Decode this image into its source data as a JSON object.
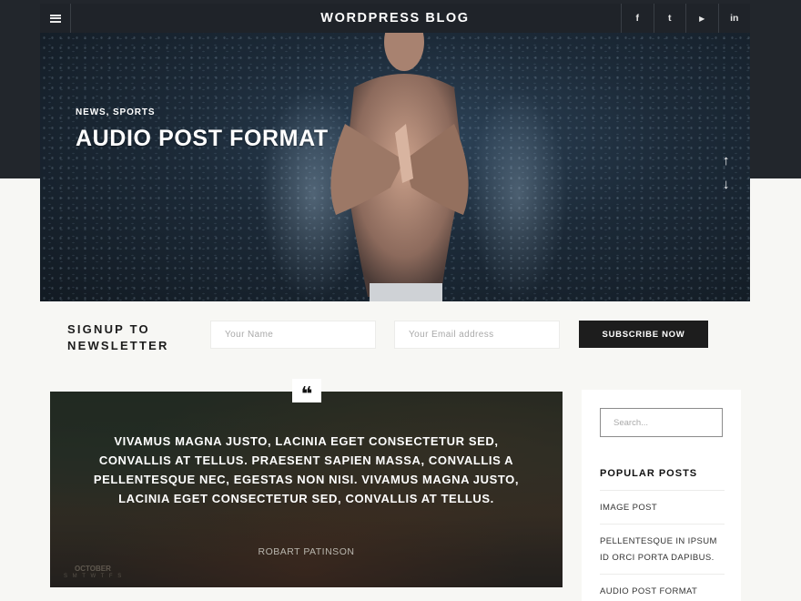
{
  "header": {
    "site_title": "WORDPRESS BLOG",
    "menu_icon": "hamburger-icon",
    "socials": [
      {
        "name": "facebook-icon",
        "glyph": "f"
      },
      {
        "name": "twitter-icon",
        "glyph": "t"
      },
      {
        "name": "youtube-icon",
        "glyph": "▶"
      },
      {
        "name": "linkedin-icon",
        "glyph": "in"
      }
    ]
  },
  "hero": {
    "categories": "NEWS, SPORTS",
    "title": "AUDIO POST FORMAT",
    "arrow_up": "↑",
    "arrow_down": "↓"
  },
  "newsletter": {
    "title_line1": "SIGNUP TO",
    "title_line2": "NEWSLETTER",
    "name_placeholder": "Your Name",
    "email_placeholder": "Your Email address",
    "button_label": "SUBSCRIBE NOW"
  },
  "quote": {
    "badge": "❝",
    "text": "VIVAMUS MAGNA JUSTO, LACINIA EGET CONSECTETUR SED, CONVALLIS AT TELLUS. PRAESENT SAPIEN MASSA, CONVALLIS A PELLENTESQUE NEC, EGESTAS NON NISI. VIVAMUS MAGNA JUSTO, LACINIA EGET CONSECTETUR SED, CONVALLIS AT TELLUS.",
    "author": "ROBART PATINSON",
    "calendar_month": "OCTOBER",
    "calendar_days": "S M T W T F S"
  },
  "sidebar": {
    "search_placeholder": "Search...",
    "popular_title": "POPULAR POSTS",
    "popular_posts": [
      "IMAGE POST",
      "PELLENTESQUE IN IPSUM ID ORCI PORTA DAPIBUS.",
      "AUDIO POST FORMAT"
    ]
  },
  "colors": {
    "header_bg": "#22262c",
    "page_bg": "#f7f7f4",
    "button_bg": "#1d1d1d"
  }
}
